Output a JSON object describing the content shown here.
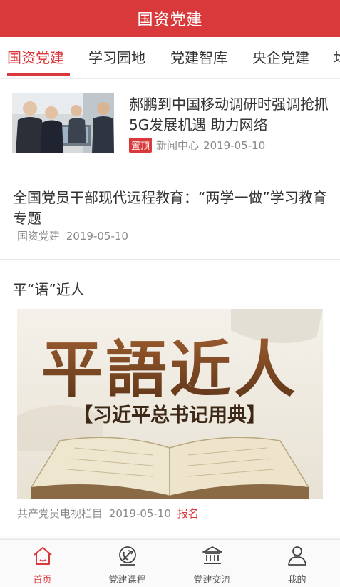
{
  "header": {
    "title": "国资党建"
  },
  "tabs": [
    {
      "label": "国资党建",
      "active": true
    },
    {
      "label": "学习园地"
    },
    {
      "label": "党建智库"
    },
    {
      "label": "央企党建"
    },
    {
      "label": "均"
    }
  ],
  "news": [
    {
      "title": "郝鹏到中国移动调研时强调抢抓5G发展机遇 助力网络",
      "badge": "置顶",
      "source": "新闻中心",
      "date": "2019-05-10"
    },
    {
      "title": "全国党员干部现代远程教育：“两学一做”学习教育专题",
      "source": "国资党建",
      "date": "2019-05-10"
    },
    {
      "title": "平“语”近人",
      "banner_big": "平語近人",
      "banner_sub": "【习近平总书记用典】",
      "source": "共产党员电视栏目",
      "date": "2019-05-10",
      "link": "报名"
    }
  ],
  "bottom_nav": [
    {
      "label": "首页",
      "icon": "home-icon",
      "active": true
    },
    {
      "label": "党建课程",
      "icon": "party-emblem-icon"
    },
    {
      "label": "党建交流",
      "icon": "bank-icon"
    },
    {
      "label": "我的",
      "icon": "user-icon"
    }
  ],
  "colors": {
    "accent": "#d9393b",
    "text": "#333333",
    "meta": "#888888"
  }
}
